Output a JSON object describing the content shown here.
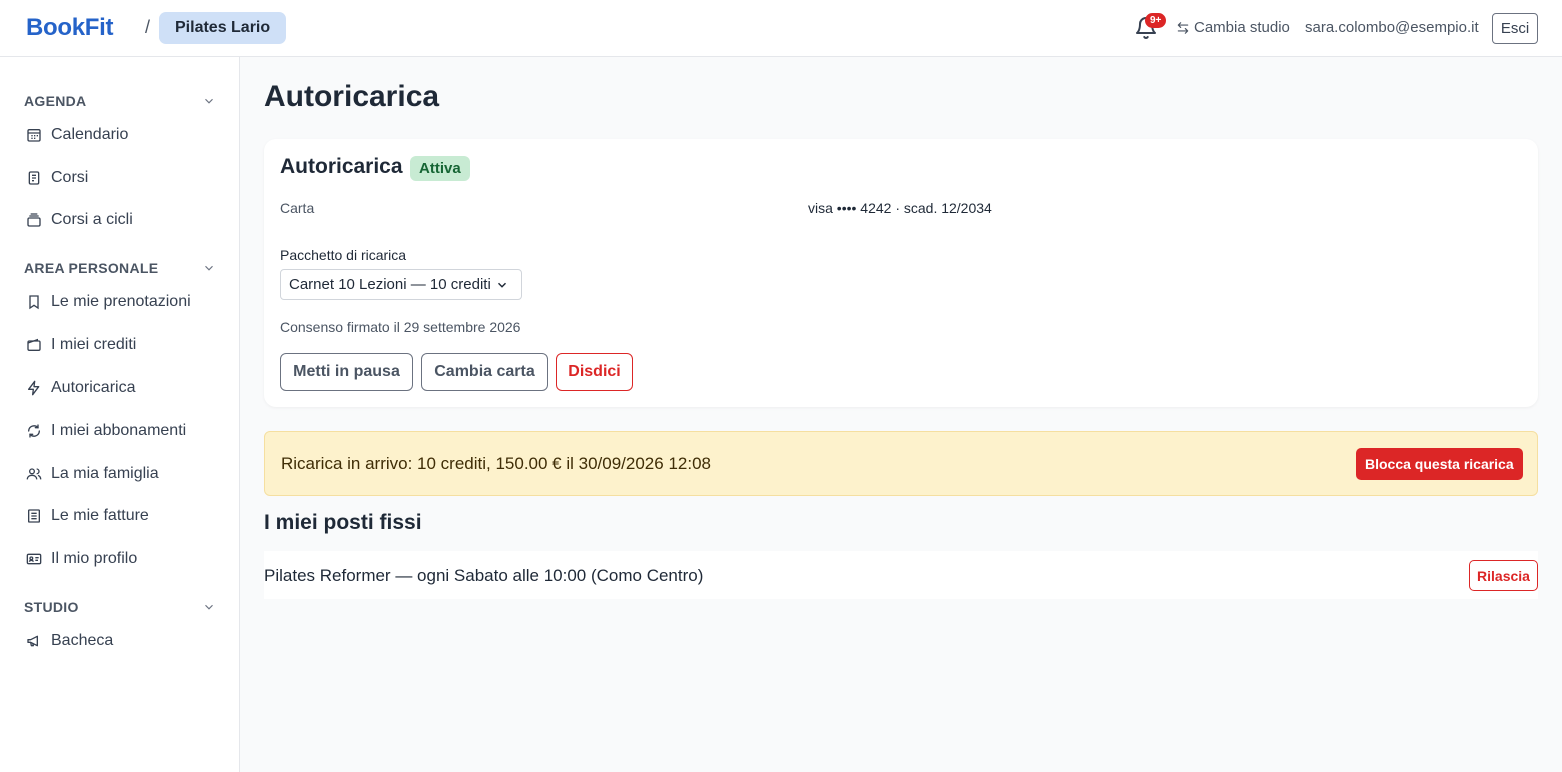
{
  "header": {
    "logo": "BookFit",
    "separator": "/",
    "studio": "Pilates Lario",
    "notification_count": "9+",
    "switch_studio": "Cambia studio",
    "user_email": "sara.colombo@esempio.it",
    "logout": "Esci"
  },
  "sidebar": {
    "sections": [
      {
        "title": "AGENDA",
        "items": [
          "Calendario",
          "Corsi",
          "Corsi a cicli"
        ]
      },
      {
        "title": "AREA PERSONALE",
        "items": [
          "Le mie prenotazioni",
          "I miei crediti",
          "Autoricarica",
          "I miei abbonamenti",
          "La mia famiglia",
          "Le mie fatture",
          "Il mio profilo"
        ]
      },
      {
        "title": "STUDIO",
        "items": [
          "Bacheca"
        ]
      }
    ]
  },
  "main": {
    "page_title": "Autoricarica",
    "card": {
      "title": "Autoricarica",
      "status": "Attiva",
      "status_color": "#166534",
      "card_label": "Carta",
      "card_value": "visa •••• 4242 · scad. 12/2034",
      "package_label": "Pacchetto di ricarica",
      "package_selected": "Carnet 10 Lezioni — 10 crediti",
      "consent": "Consenso firmato il 29 settembre 2026",
      "buttons": {
        "pause": "Metti in pausa",
        "change_card": "Cambia carta",
        "cancel": "Disdici"
      }
    },
    "alert": {
      "text": "Ricarica in arrivo: 10 crediti, 150.00 € il 30/09/2026 12:08",
      "button": "Blocca questa ricarica"
    },
    "fixed_slots": {
      "title": "I miei posti fissi",
      "items": [
        {
          "text": "Pilates Reformer — ogni Sabato alle 10:00 (Como Centro)",
          "action": "Rilascia"
        }
      ]
    }
  },
  "colors": {
    "brand": "#2563c9",
    "danger": "#dc2626",
    "alert_bg": "#fdf2cc"
  }
}
